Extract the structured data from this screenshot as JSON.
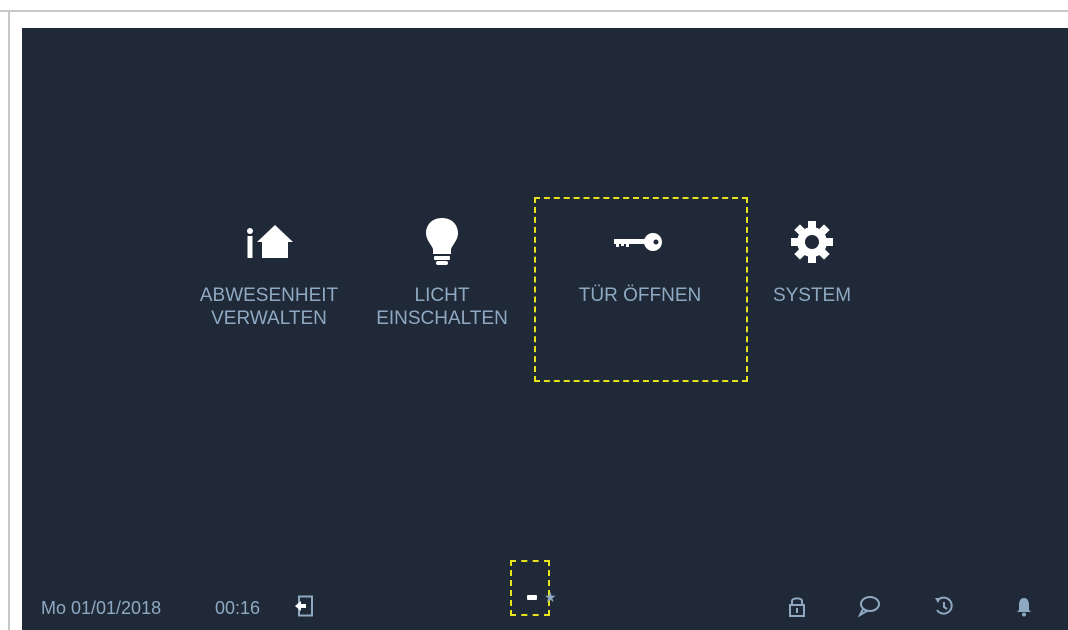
{
  "tiles": [
    {
      "label": "ABWESENHEIT\nVERWALTEN",
      "icon": "home-absence-icon"
    },
    {
      "label": "LICHT\nEINSCHALTEN",
      "icon": "light-bulb-icon"
    },
    {
      "label": "TÜR ÖFFNEN",
      "icon": "key-icon"
    },
    {
      "label": "SYSTEM",
      "icon": "gear-icon"
    }
  ],
  "status": {
    "date": "Mo 01/01/2018",
    "time": "00:16",
    "icons": [
      "exit-door-icon",
      "lock-icon",
      "chat-bubble-icon",
      "history-icon",
      "bell-icon"
    ]
  },
  "pager": {
    "current_page": 1,
    "pages": 2,
    "favorites_icon": "star-icon"
  },
  "colors": {
    "background": "#1f2937",
    "label": "#8fa9c2",
    "highlight": "#e8e21c"
  }
}
